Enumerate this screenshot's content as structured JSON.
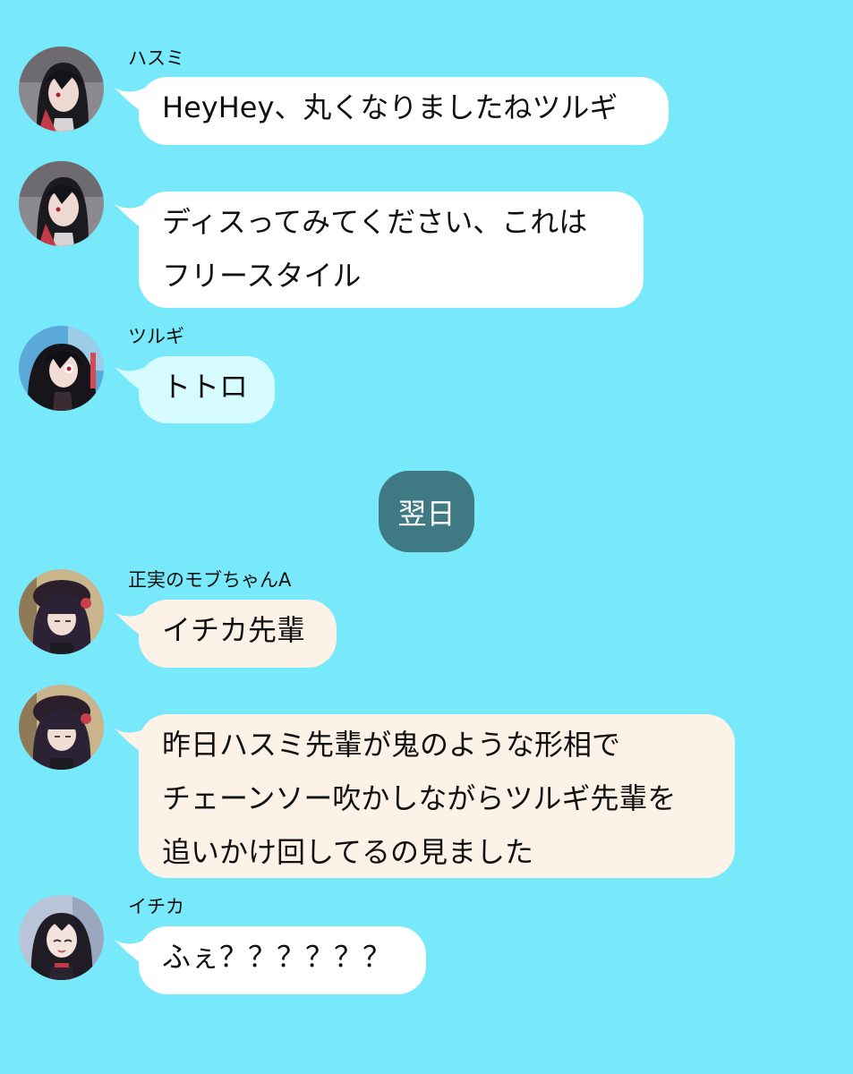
{
  "chat": {
    "messages": [
      {
        "sender": "ハスミ",
        "lines": [
          "HeyHey、丸くなりましたねツルギ"
        ],
        "avatar": "hasumi-avatar"
      },
      {
        "sender": "",
        "lines": [
          "ディスってみてください、これは",
          "フリースタイル"
        ],
        "avatar": "hasumi-avatar"
      },
      {
        "sender": "ツルギ",
        "lines": [
          "トトロ"
        ],
        "avatar": "tsurugi-avatar"
      },
      {
        "sender": "正実のモブちゃんA",
        "lines": [
          "イチカ先輩"
        ],
        "avatar": "mob-chan-avatar"
      },
      {
        "sender": "",
        "lines": [
          "昨日ハスミ先輩が鬼のような形相で",
          "チェーンソー吹かしながらツルギ先輩を",
          "追いかけ回してるの見ました"
        ],
        "avatar": "mob-chan-avatar"
      },
      {
        "sender": "イチカ",
        "lines": [
          "ふぇ？？？？？？"
        ],
        "avatar": "ichika-avatar"
      }
    ],
    "date_divider": "翌日"
  },
  "colors": {
    "background": "#78e8fb",
    "bubble_white": "#ffffff",
    "bubble_cyan": "#d6fcff",
    "bubble_cream": "#fdf2e8",
    "date_pill": "#3f7a84"
  }
}
